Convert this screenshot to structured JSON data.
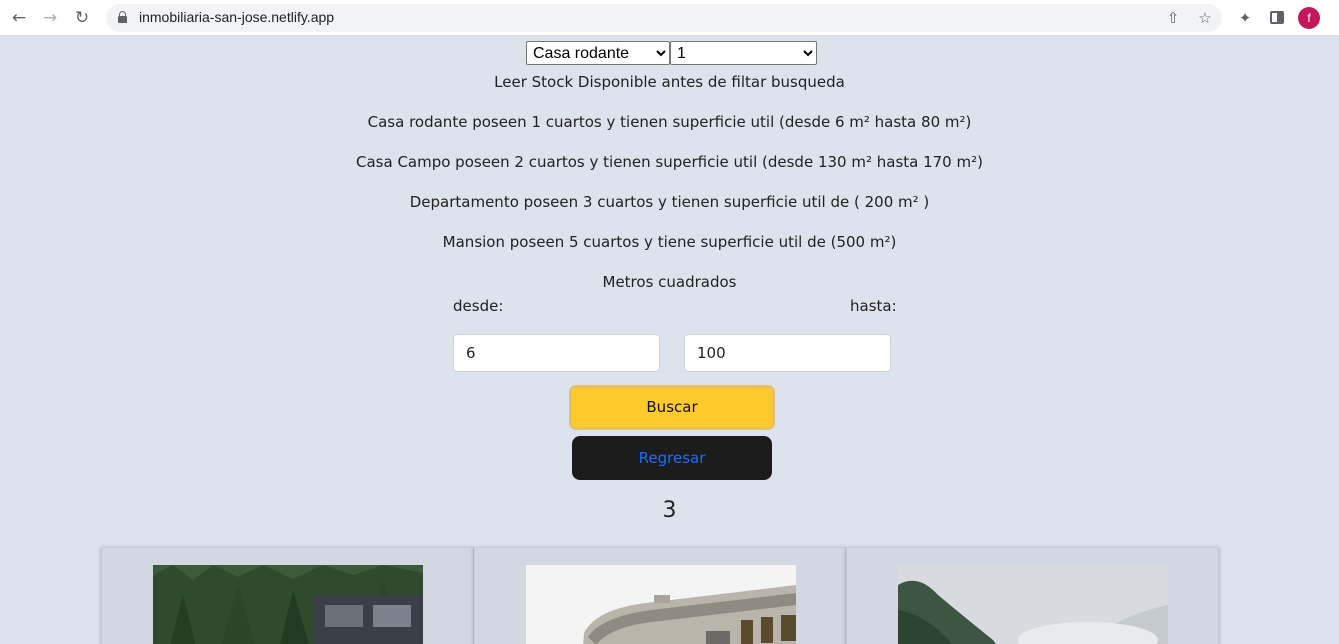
{
  "browser": {
    "url": "inmobiliaria-san-jose.netlify.app",
    "profile_initial": "f"
  },
  "filters": {
    "tipo_selected": "Casa rodante",
    "tipo_options": [
      "Casa rodante",
      "Casa Campo",
      "Departamento",
      "Mansion"
    ],
    "cuartos_selected": "1",
    "cuartos_options": [
      "1",
      "2",
      "3",
      "5"
    ]
  },
  "info": {
    "stock_note": "Leer Stock Disponible antes de filtar busqueda",
    "lines": [
      "Casa rodante poseen 1 cuartos y tienen superficie util (desde 6 m² hasta 80 m²)",
      "Casa Campo poseen 2 cuartos y tienen superficie util (desde 130 m² hasta 170 m²)",
      "Departamento poseen 3 cuartos y tienen superficie util de ( 200 m² )",
      "Mansion poseen 5 cuartos y tiene superficie util de (500 m²)"
    ]
  },
  "area": {
    "title": "Metros cuadrados",
    "desde_label": "desde:",
    "hasta_label": "hasta:",
    "desde_value": "6",
    "hasta_value": "100"
  },
  "buttons": {
    "buscar": "Buscar",
    "regresar": "Regresar"
  },
  "results": {
    "count": "3",
    "cards": [
      {
        "image": "forest-trailer-photo"
      },
      {
        "image": "rv-motorhome-photo"
      },
      {
        "image": "mountain-landscape-photo"
      }
    ]
  },
  "colors": {
    "page_bg": "#dde3ec",
    "buscar_bg": "#ffca2c",
    "regresar_bg": "#1c1c1c",
    "regresar_text": "#1e6bff",
    "card_bg": "#d2d7e1",
    "avatar_bg": "#c2185b"
  }
}
